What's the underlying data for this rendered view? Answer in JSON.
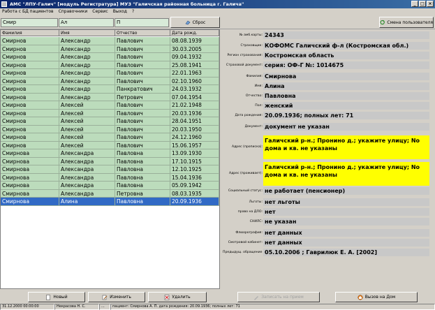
{
  "window": {
    "title": "АМС \"ЛПУ-Галич\" [модуль Регистратура]     МУЗ \"Галичская районная больница г. Галича\""
  },
  "menu": [
    "Работа с БД пациентов",
    "Справочники",
    "Сервис",
    "Выход",
    "?"
  ],
  "filters": {
    "surname": "Смир",
    "name": "Ал",
    "patronymic": "П",
    "reset_label": "Сброс"
  },
  "change_user_label": "Смена пользователя",
  "grid": {
    "headers": [
      "Фамилия",
      "Имя",
      "Отчество",
      "Дата рожд."
    ],
    "rows": [
      [
        "Смирнов",
        "Александр",
        "Павлович",
        "08.08.1939"
      ],
      [
        "Смирнов",
        "Александр",
        "Павлович",
        "30.03.2005"
      ],
      [
        "Смирнов",
        "Александр",
        "Павлович",
        "09.04.1932"
      ],
      [
        "Смирнов",
        "Александр",
        "Павлович",
        "25.08.1941"
      ],
      [
        "Смирнов",
        "Александр",
        "Павлович",
        "22.01.1963"
      ],
      [
        "Смирнов",
        "Александр",
        "Павлович",
        "02.10.1960"
      ],
      [
        "Смирнов",
        "Александр",
        "Панкратович",
        "24.03.1932"
      ],
      [
        "Смирнов",
        "Александр",
        "Петрович",
        "07.04.1954"
      ],
      [
        "Смирнов",
        "Алексей",
        "Павлович",
        "21.02.1948"
      ],
      [
        "Смирнов",
        "Алексей",
        "Павлович",
        "20.03.1936"
      ],
      [
        "Смирнов",
        "Алексей",
        "Павлович",
        "28.04.1951"
      ],
      [
        "Смирнов",
        "Алексей",
        "Павлович",
        "20.03.1950"
      ],
      [
        "Смирнов",
        "Алексей",
        "Павлович",
        "24.12.1960"
      ],
      [
        "Смирнов",
        "Алексей",
        "Павлович",
        "15.06.1957"
      ],
      [
        "Смирнова",
        "Александра",
        "Павловна",
        "13.09.1930"
      ],
      [
        "Смирнова",
        "Александра",
        "Павловна",
        "17.10.1915"
      ],
      [
        "Смирнова",
        "Александра",
        "Павловна",
        "12.10.1925"
      ],
      [
        "Смирнова",
        "Александра",
        "Павловна",
        "15.04.1936"
      ],
      [
        "Смирнова",
        "Александра",
        "Павловна",
        "05.09.1942"
      ],
      [
        "Смирнова",
        "Александра",
        "Петровна",
        "08.03.1935"
      ],
      [
        "Смирнова",
        "Алина",
        "Павловна",
        "20.09.1936"
      ]
    ],
    "selected_row": 20
  },
  "detail": [
    {
      "label": "№ амб.карты:",
      "value": "24343"
    },
    {
      "label": "Страховщик:",
      "value": "КОФОМС Галичский ф-л  (Костромская обл.)"
    },
    {
      "label": "Регион страхования:",
      "value": "Костромская область"
    },
    {
      "label": "Страховой документ:",
      "value": "серия: ОФ-Г  №: 1014675"
    },
    {
      "label": "Фамилия:",
      "value": "Смирнова"
    },
    {
      "label": "Имя:",
      "value": "Алина"
    },
    {
      "label": "Отчество:",
      "value": "Павловна"
    },
    {
      "label": "Пол:",
      "value": "женский"
    },
    {
      "label": "Дата рождения:",
      "value": "20.09.1936;  полных лет: 71"
    },
    {
      "label": "Документ:",
      "value": "документ не указан"
    },
    {
      "label": "Адрес (прописка):",
      "value": "Галичский р-н.; Пронино д.; укажите улицу; No дома и кв. не указаны"
    },
    {
      "label": "Адрес (проживает):",
      "value": "Галичский р-н.; Пронино д.; укажите улицу; No дома и кв. не указаны"
    },
    {
      "label": "Социальный статус:",
      "value": "не работает (пенсионер)"
    },
    {
      "label": "Льготы:",
      "value": "нет льготы"
    },
    {
      "label": "право на ДЛО:",
      "value": "нет"
    },
    {
      "label": "СНИЛС:",
      "value": "не указан"
    },
    {
      "label": "Флюорография:",
      "value": "нет данных"
    },
    {
      "label": "Смотровой кабинет:",
      "value": "нет данных"
    },
    {
      "label": "Предыдущ. обращение:",
      "value": "05.10.2006 ;   Гаврилюк Е. А.   [2002]"
    }
  ],
  "buttons": {
    "new": "Новый",
    "edit": "Изменить",
    "delete": "Удалить",
    "record": "Записать на прием",
    "call": "Вызов на Дом"
  },
  "status": [
    "31.12.2000 00:00:00",
    "Некрасова Н. С.",
    "...",
    "пациент: Смирнова А. П.  дата рождения: 20.09.1936;  полных лет: 71"
  ]
}
